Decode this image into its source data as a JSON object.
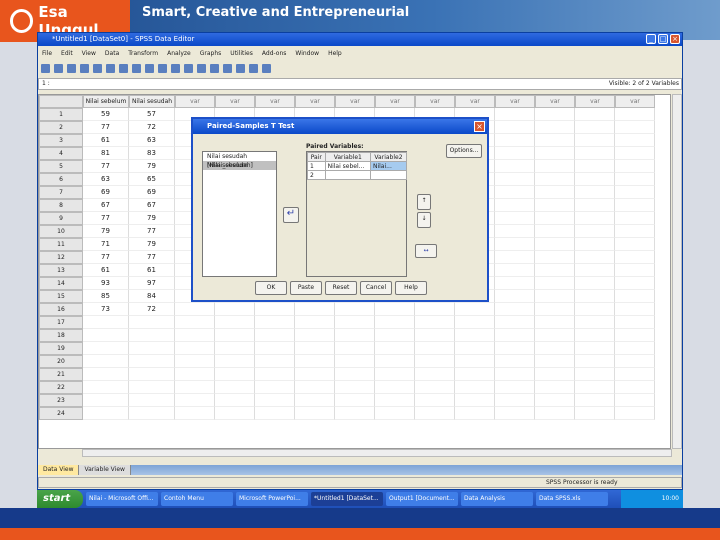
{
  "banner": {
    "logo_text": "Esa Unggul",
    "tagline": "Smart, Creative and Entrepreneurial"
  },
  "window": {
    "title": "*Untitled1 [DataSet0] - SPSS Data Editor",
    "menu": [
      "File",
      "Edit",
      "View",
      "Data",
      "Transform",
      "Analyze",
      "Graphs",
      "Utilities",
      "Add-ons",
      "Window",
      "Help"
    ],
    "cell_ref": "1 :",
    "visible": "Visible: 2 of 2 Variables",
    "columns": [
      "Nilai sebelum",
      "Nilai sesudah",
      "var",
      "var",
      "var",
      "var",
      "var",
      "var",
      "var",
      "var",
      "var",
      "var",
      "var",
      "var"
    ],
    "rows": [
      [
        "59",
        "57"
      ],
      [
        "77",
        "72"
      ],
      [
        "61",
        "63"
      ],
      [
        "81",
        "83"
      ],
      [
        "77",
        "79"
      ],
      [
        "63",
        "65"
      ],
      [
        "69",
        "69"
      ],
      [
        "67",
        "67"
      ],
      [
        "77",
        "79"
      ],
      [
        "79",
        "77"
      ],
      [
        "71",
        "79"
      ],
      [
        "77",
        "77"
      ],
      [
        "61",
        "61"
      ],
      [
        "93",
        "97"
      ],
      [
        "85",
        "84"
      ],
      [
        "73",
        "72"
      ]
    ],
    "row_count": 24,
    "tabs": [
      "Data View",
      "Variable View"
    ],
    "status": "SPSS Processor is ready"
  },
  "dialog": {
    "title": "Paired-Samples T Test",
    "source_vars": [
      "Nilai sesudah [Nilai_sesudah]",
      "Nilai sebelum"
    ],
    "paired_label": "Paired Variables:",
    "pair_headers": [
      "Pair",
      "Variable1",
      "Variable2"
    ],
    "pairs": [
      [
        "1",
        "Nilai sebel...",
        "Nilai..."
      ],
      [
        "2",
        "",
        ""
      ]
    ],
    "options": "Options...",
    "buttons": [
      "OK",
      "Paste",
      "Reset",
      "Cancel",
      "Help"
    ]
  },
  "taskbar": {
    "start": "start",
    "items": [
      "Nilai - Microsoft Offi...",
      "Contoh Menu",
      "Microsoft PowerPoi...",
      "*Untitled1 [DataSet...",
      "Output1 [Document...",
      "Data Analysis",
      "Data SPSS.xls"
    ],
    "active": 3,
    "clock": "10:00"
  }
}
